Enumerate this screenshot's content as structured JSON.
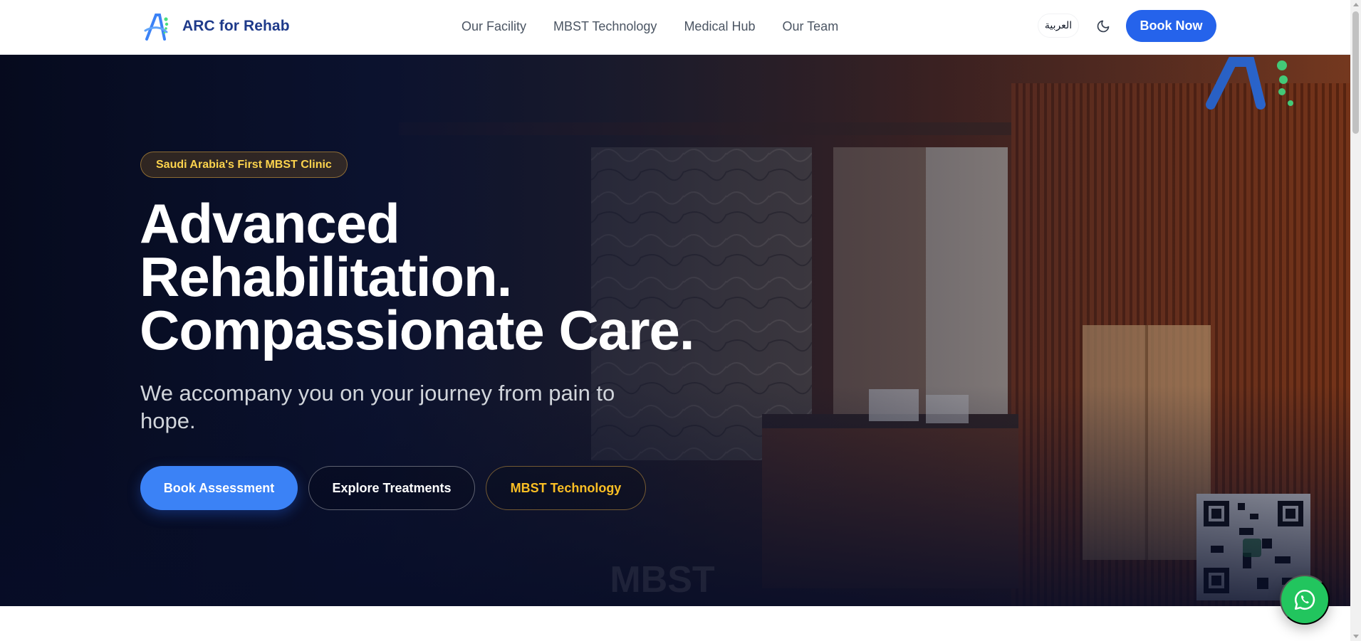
{
  "header": {
    "brand_name": "ARC for Rehab",
    "nav": [
      {
        "label": "Our Facility"
      },
      {
        "label": "MBST Technology"
      },
      {
        "label": "Medical Hub"
      },
      {
        "label": "Our Team"
      }
    ],
    "language_label": "العربية",
    "theme_icon": "moon-icon",
    "book_now_label": "Book Now"
  },
  "hero": {
    "badge": "Saudi Arabia's First MBST Clinic",
    "title_lines": [
      "Advanced",
      "Rehabilitation.",
      "Compassionate Care."
    ],
    "subtitle": "We accompany you on your journey from pain to hope.",
    "buttons": {
      "primary": "Book Assessment",
      "secondary": "Explore Treatments",
      "tertiary": "MBST Technology"
    },
    "background_watermark": "MBST"
  },
  "floating": {
    "whatsapp_icon": "whatsapp-icon"
  },
  "colors": {
    "brand_blue": "#2563eb",
    "cta_blue": "#3b82f6",
    "brand_navy": "#1e3a8a",
    "gold": "#fbbf24",
    "whatsapp_green": "#22c55e"
  }
}
